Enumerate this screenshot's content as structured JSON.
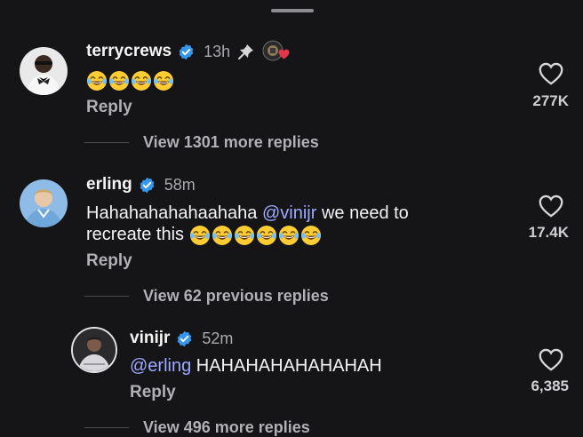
{
  "comments": [
    {
      "username": "terrycrews",
      "time": "13h",
      "text": "",
      "emoji_count": 4,
      "reply_label": "Reply",
      "likes": "277K",
      "view_replies": "View 1301 more replies"
    },
    {
      "username": "erling",
      "time": "58m",
      "text_before": "Hahahahahahaahaha ",
      "mention": "@vinijr",
      "text_after": " we need to",
      "text_line2": "recreate this ",
      "emoji_count": 6,
      "reply_label": "Reply",
      "likes": "17.4K",
      "view_replies": "View 62 previous replies"
    },
    {
      "username": "vinijr",
      "time": "52m",
      "mention": "@erling",
      "text_after": " HAHAHAHAHAHAHAH",
      "reply_label": "Reply",
      "likes": "6,385",
      "view_replies": "View 496 more replies"
    }
  ],
  "colors": {
    "background": "#151517",
    "verified": "#3797f0",
    "mention": "#9ea9ff",
    "muted": "#b0b0b5",
    "heart_pin": "#e0384a"
  },
  "icons": {
    "verified": "verified-badge-icon",
    "pin": "pin-icon",
    "heart": "heart-outline-icon",
    "emoji": "laughing-with-tears-emoji"
  }
}
